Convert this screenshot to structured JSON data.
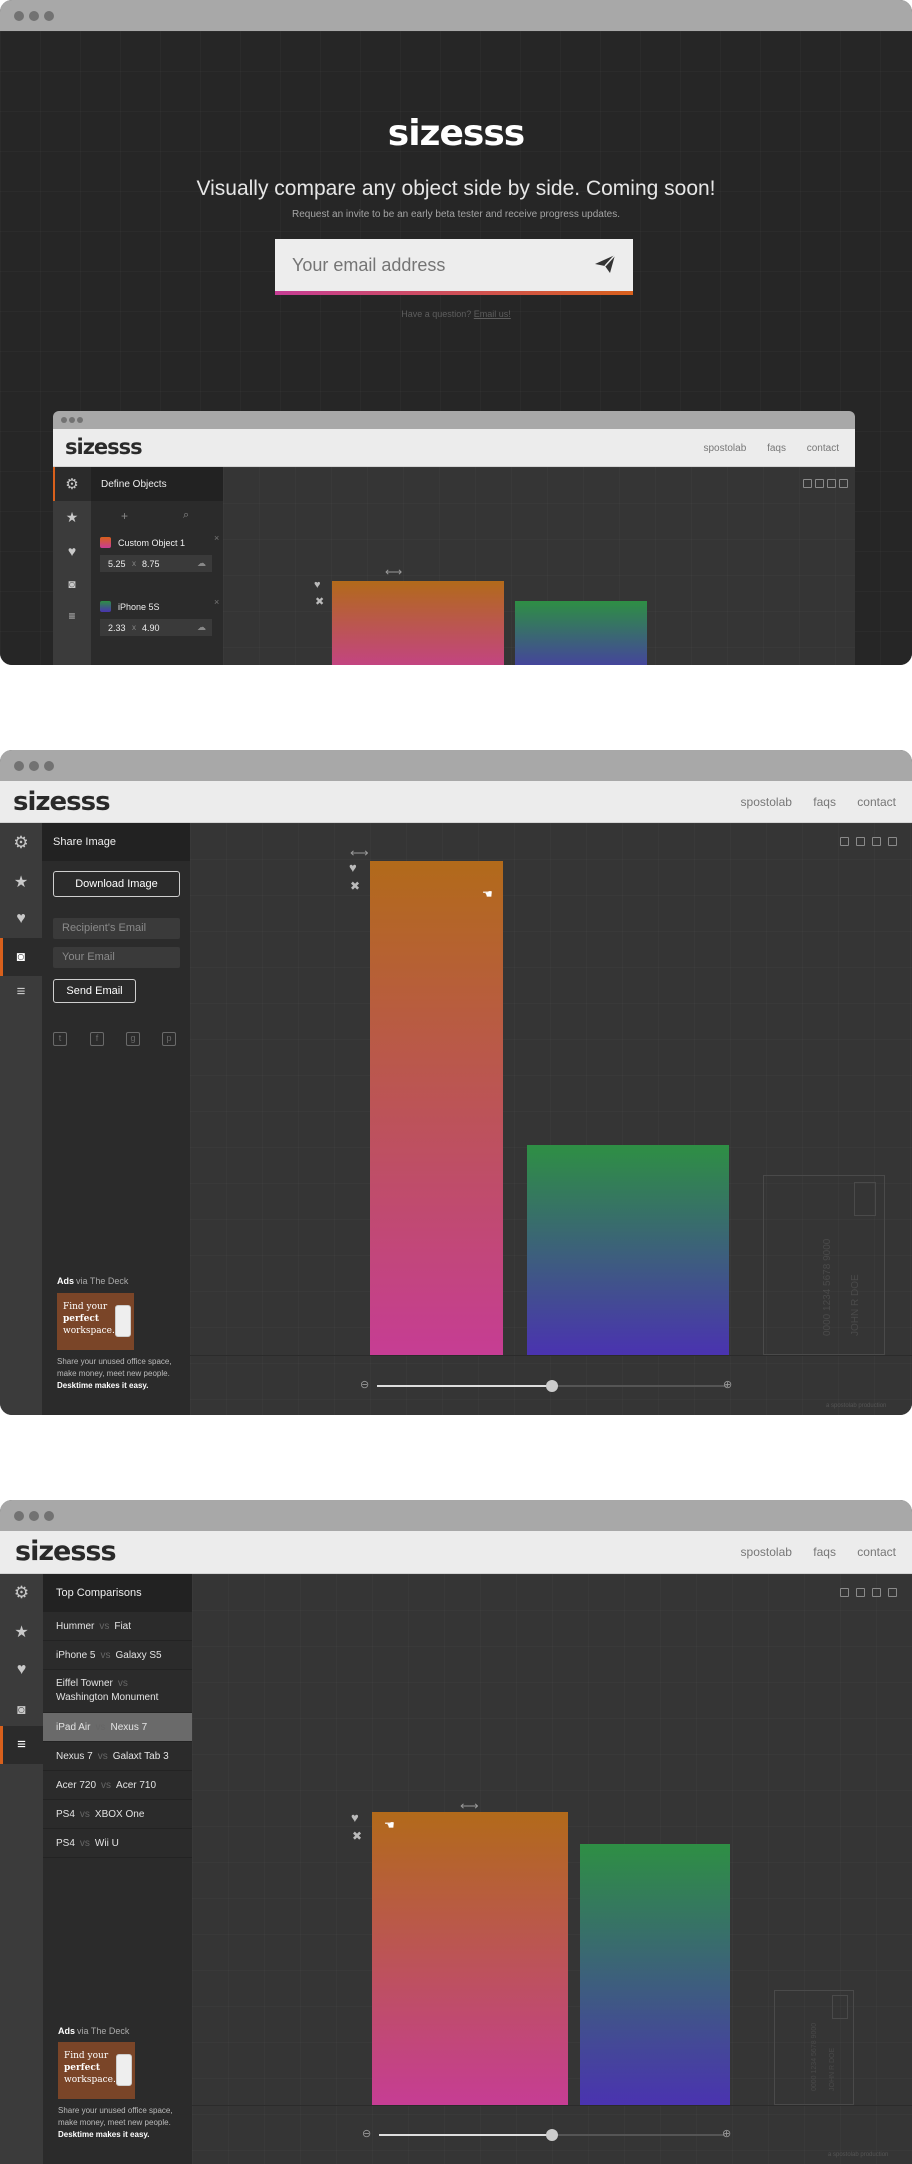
{
  "brand": "sizesss",
  "hero": {
    "headline": "Visually compare any object side by side. Coming soon!",
    "subline": "Request an invite to be an early beta tester and receive progress updates.",
    "email_placeholder": "Your email address",
    "question": "Have a question?",
    "question_link": "Email us!"
  },
  "nav": {
    "links": [
      "spostolab",
      "faqs",
      "contact"
    ]
  },
  "mini": {
    "panel_title": "Define Objects",
    "objects": [
      {
        "name": "Custom Object 1",
        "w": "5.25",
        "h": "8.75",
        "color": "#d8601c"
      },
      {
        "name": "iPhone 5S",
        "w": "2.33",
        "h": "4.90",
        "color": "#3a7a4e"
      }
    ],
    "times": "x"
  },
  "share": {
    "title": "Share Image",
    "download": "Download Image",
    "recipient_placeholder": "Recipient's Email",
    "your_email_placeholder": "Your Email",
    "send": "Send Email"
  },
  "ads": {
    "label": "Ads",
    "via": "via The Deck",
    "img_line1": "Find your",
    "img_line2": "perfect",
    "img_line3": "workspace.",
    "text": "Share your unused office space, make money, meet new people.",
    "bold": "Desktime makes it easy."
  },
  "comparisons": {
    "title": "Top Comparisons",
    "vs": "vs",
    "items": [
      {
        "a": "Hummer",
        "b": "Fiat"
      },
      {
        "a": "iPhone 5",
        "b": "Galaxy S5"
      },
      {
        "a": "Eiffel Towner",
        "b": "Washington Monument"
      },
      {
        "a": "iPad Air",
        "b": "Nexus 7"
      },
      {
        "a": "Nexus 7",
        "b": "Galaxt Tab 3"
      },
      {
        "a": "Acer 720",
        "b": "Acer 710"
      },
      {
        "a": "PS4",
        "b": "XBOX One"
      },
      {
        "a": "PS4",
        "b": "Wii U"
      }
    ],
    "selected_index": 3
  },
  "credit_card": {
    "number": "0000 1234 5678 9000",
    "name": "JOHN R DOE"
  },
  "footer_credit": "a spostolab production",
  "zoom": {
    "shot2": 0.5,
    "shot3": 0.5
  },
  "colors": {
    "accent": "#d8601c",
    "orange": "#b26a1a",
    "pink": "#c63d94",
    "green": "#2e8f44",
    "purple": "#4a33b0"
  }
}
